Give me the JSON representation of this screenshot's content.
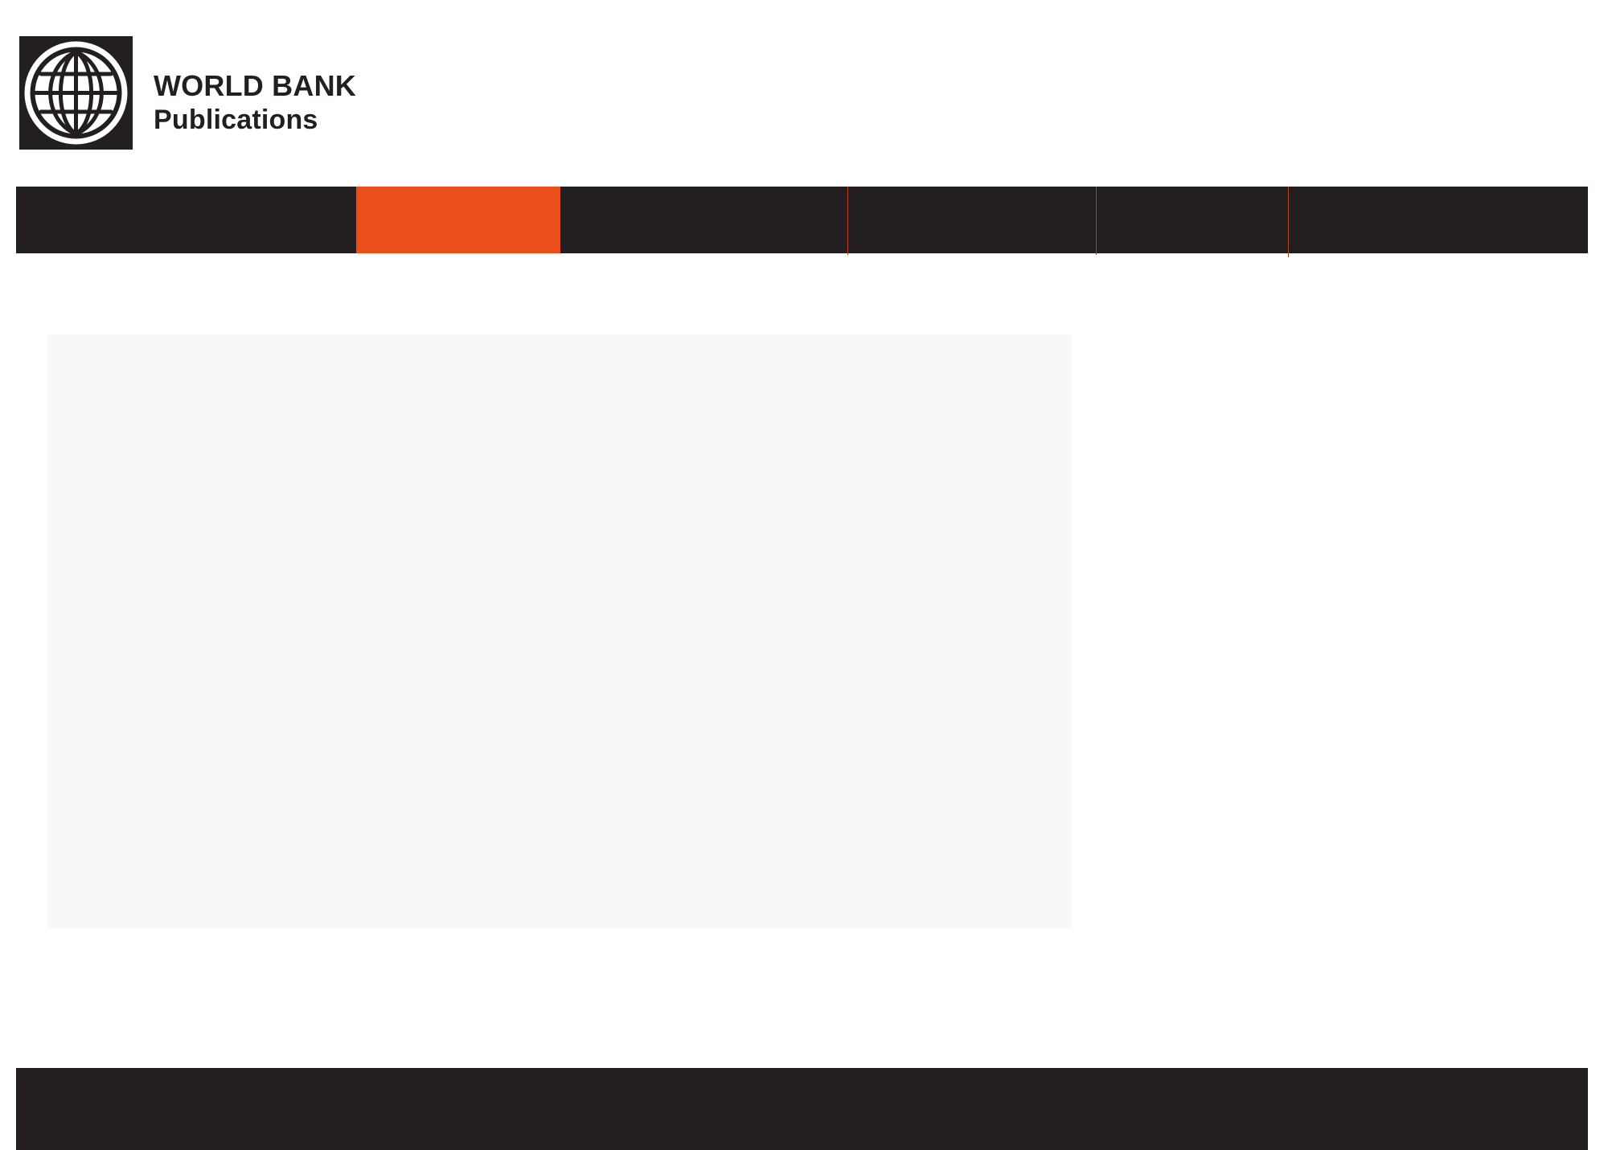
{
  "brand": {
    "title": "WORLD BANK",
    "subtitle": "Publications",
    "logo_icon": "globe-icon"
  },
  "nav": {
    "items": [
      {
        "label": ""
      },
      {
        "label": ""
      },
      {
        "label": ""
      },
      {
        "label": ""
      },
      {
        "label": ""
      },
      {
        "label": ""
      }
    ],
    "active_index": 1
  },
  "colors": {
    "nav_background": "#231f20",
    "nav_active": "#e94e1b",
    "content_panel": "#f7f8fa",
    "footer_background": "#231f20",
    "brand_text": "#231f20"
  }
}
